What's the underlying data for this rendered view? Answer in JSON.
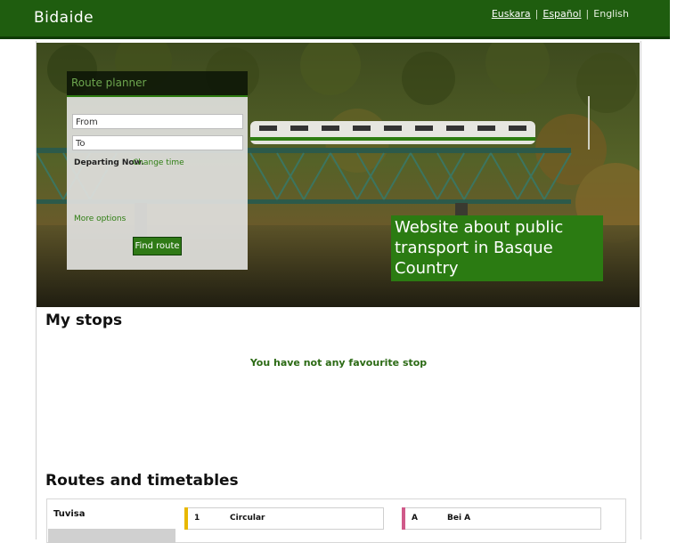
{
  "header": {
    "brand": "Bidaide",
    "languages": [
      "Euskara",
      "Español",
      "English"
    ],
    "colors": {
      "bar": "#1f5d0f",
      "accent": "#2b7b12"
    }
  },
  "planner": {
    "tab_label": "Route planner",
    "from_placeholder": "From",
    "to_placeholder": "To",
    "departing": "Departing Now.",
    "change_time": "Change time",
    "more_options": "More options",
    "find_button": "Find route"
  },
  "hero": {
    "tagline": "Website about public transport in Basque Country"
  },
  "stops": {
    "title": "My stops",
    "empty_message": "You have not any favourite stop"
  },
  "routes": {
    "title": "Routes and timetables",
    "operator": "Tuvisa",
    "items": [
      {
        "code": "1",
        "name": "Circular",
        "color": "#e8b800"
      },
      {
        "code": "A",
        "name": "Bei A",
        "color": "#d05a8a"
      }
    ]
  }
}
